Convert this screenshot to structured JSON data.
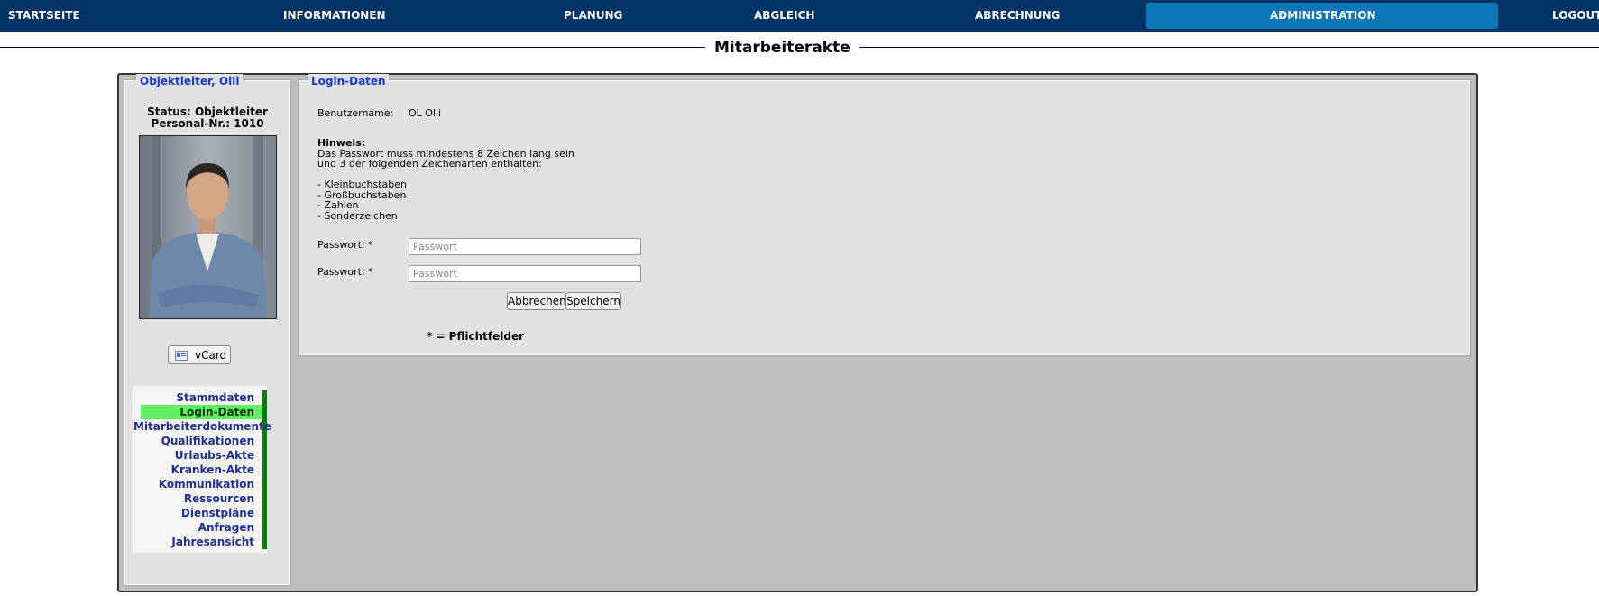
{
  "nav": {
    "items": [
      {
        "label": "STARTSEITE"
      },
      {
        "label": "INFORMATIONEN"
      },
      {
        "label": "PLANUNG"
      },
      {
        "label": "ABGLEICH"
      },
      {
        "label": "ABRECHNUNG"
      },
      {
        "label": "ADMINISTRATION",
        "active": true
      },
      {
        "label": "LOGOUT"
      }
    ]
  },
  "page": {
    "title": "Mitarbeiterakte"
  },
  "employee": {
    "name": "Objektleiter, Olli",
    "status": "Status: Objektleiter",
    "personnel_number": "Personal-Nr.: 1010",
    "vcard_label": "vCard"
  },
  "menu": {
    "items": [
      {
        "label": "Stammdaten"
      },
      {
        "label": "Login-Daten",
        "active": true
      },
      {
        "label": "Mitarbeiterdokumente"
      },
      {
        "label": "Qualifikationen"
      },
      {
        "label": "Urlaubs-Akte"
      },
      {
        "label": "Kranken-Akte"
      },
      {
        "label": "Kommunikation"
      },
      {
        "label": "Ressourcen"
      },
      {
        "label": "Dienstpläne"
      },
      {
        "label": "Anfragen"
      },
      {
        "label": "Jahresansicht"
      }
    ]
  },
  "login": {
    "section_title": "Login-Daten",
    "username_label": "Benutzername:",
    "username_value": "OL Olli",
    "hint_title": "Hinweis:",
    "hint_line1": "Das Passwort muss mindestens 8 Zeichen lang sein",
    "hint_line2": "und 3 der folgenden Zeichenarten enthalten:",
    "rules": [
      "- Kleinbuchstaben",
      "- Großbuchstaben",
      "- Zahlen",
      "- Sonderzeichen"
    ],
    "password_label": "Passwort: *",
    "password_confirm_label": "Passwort: *",
    "password_placeholder": "Passwort",
    "password_confirm_placeholder": "Passwort",
    "cancel_label": "Abbrechen",
    "save_label": "Speichern",
    "required_note": "* = Pflichtfelder"
  },
  "colors": {
    "nav_bg": "#003366",
    "nav_active": "#0A77B8",
    "menu_active": "#5EF05E",
    "menu_marker": "#0A7A0A",
    "legend_text": "#1A3AD6"
  }
}
